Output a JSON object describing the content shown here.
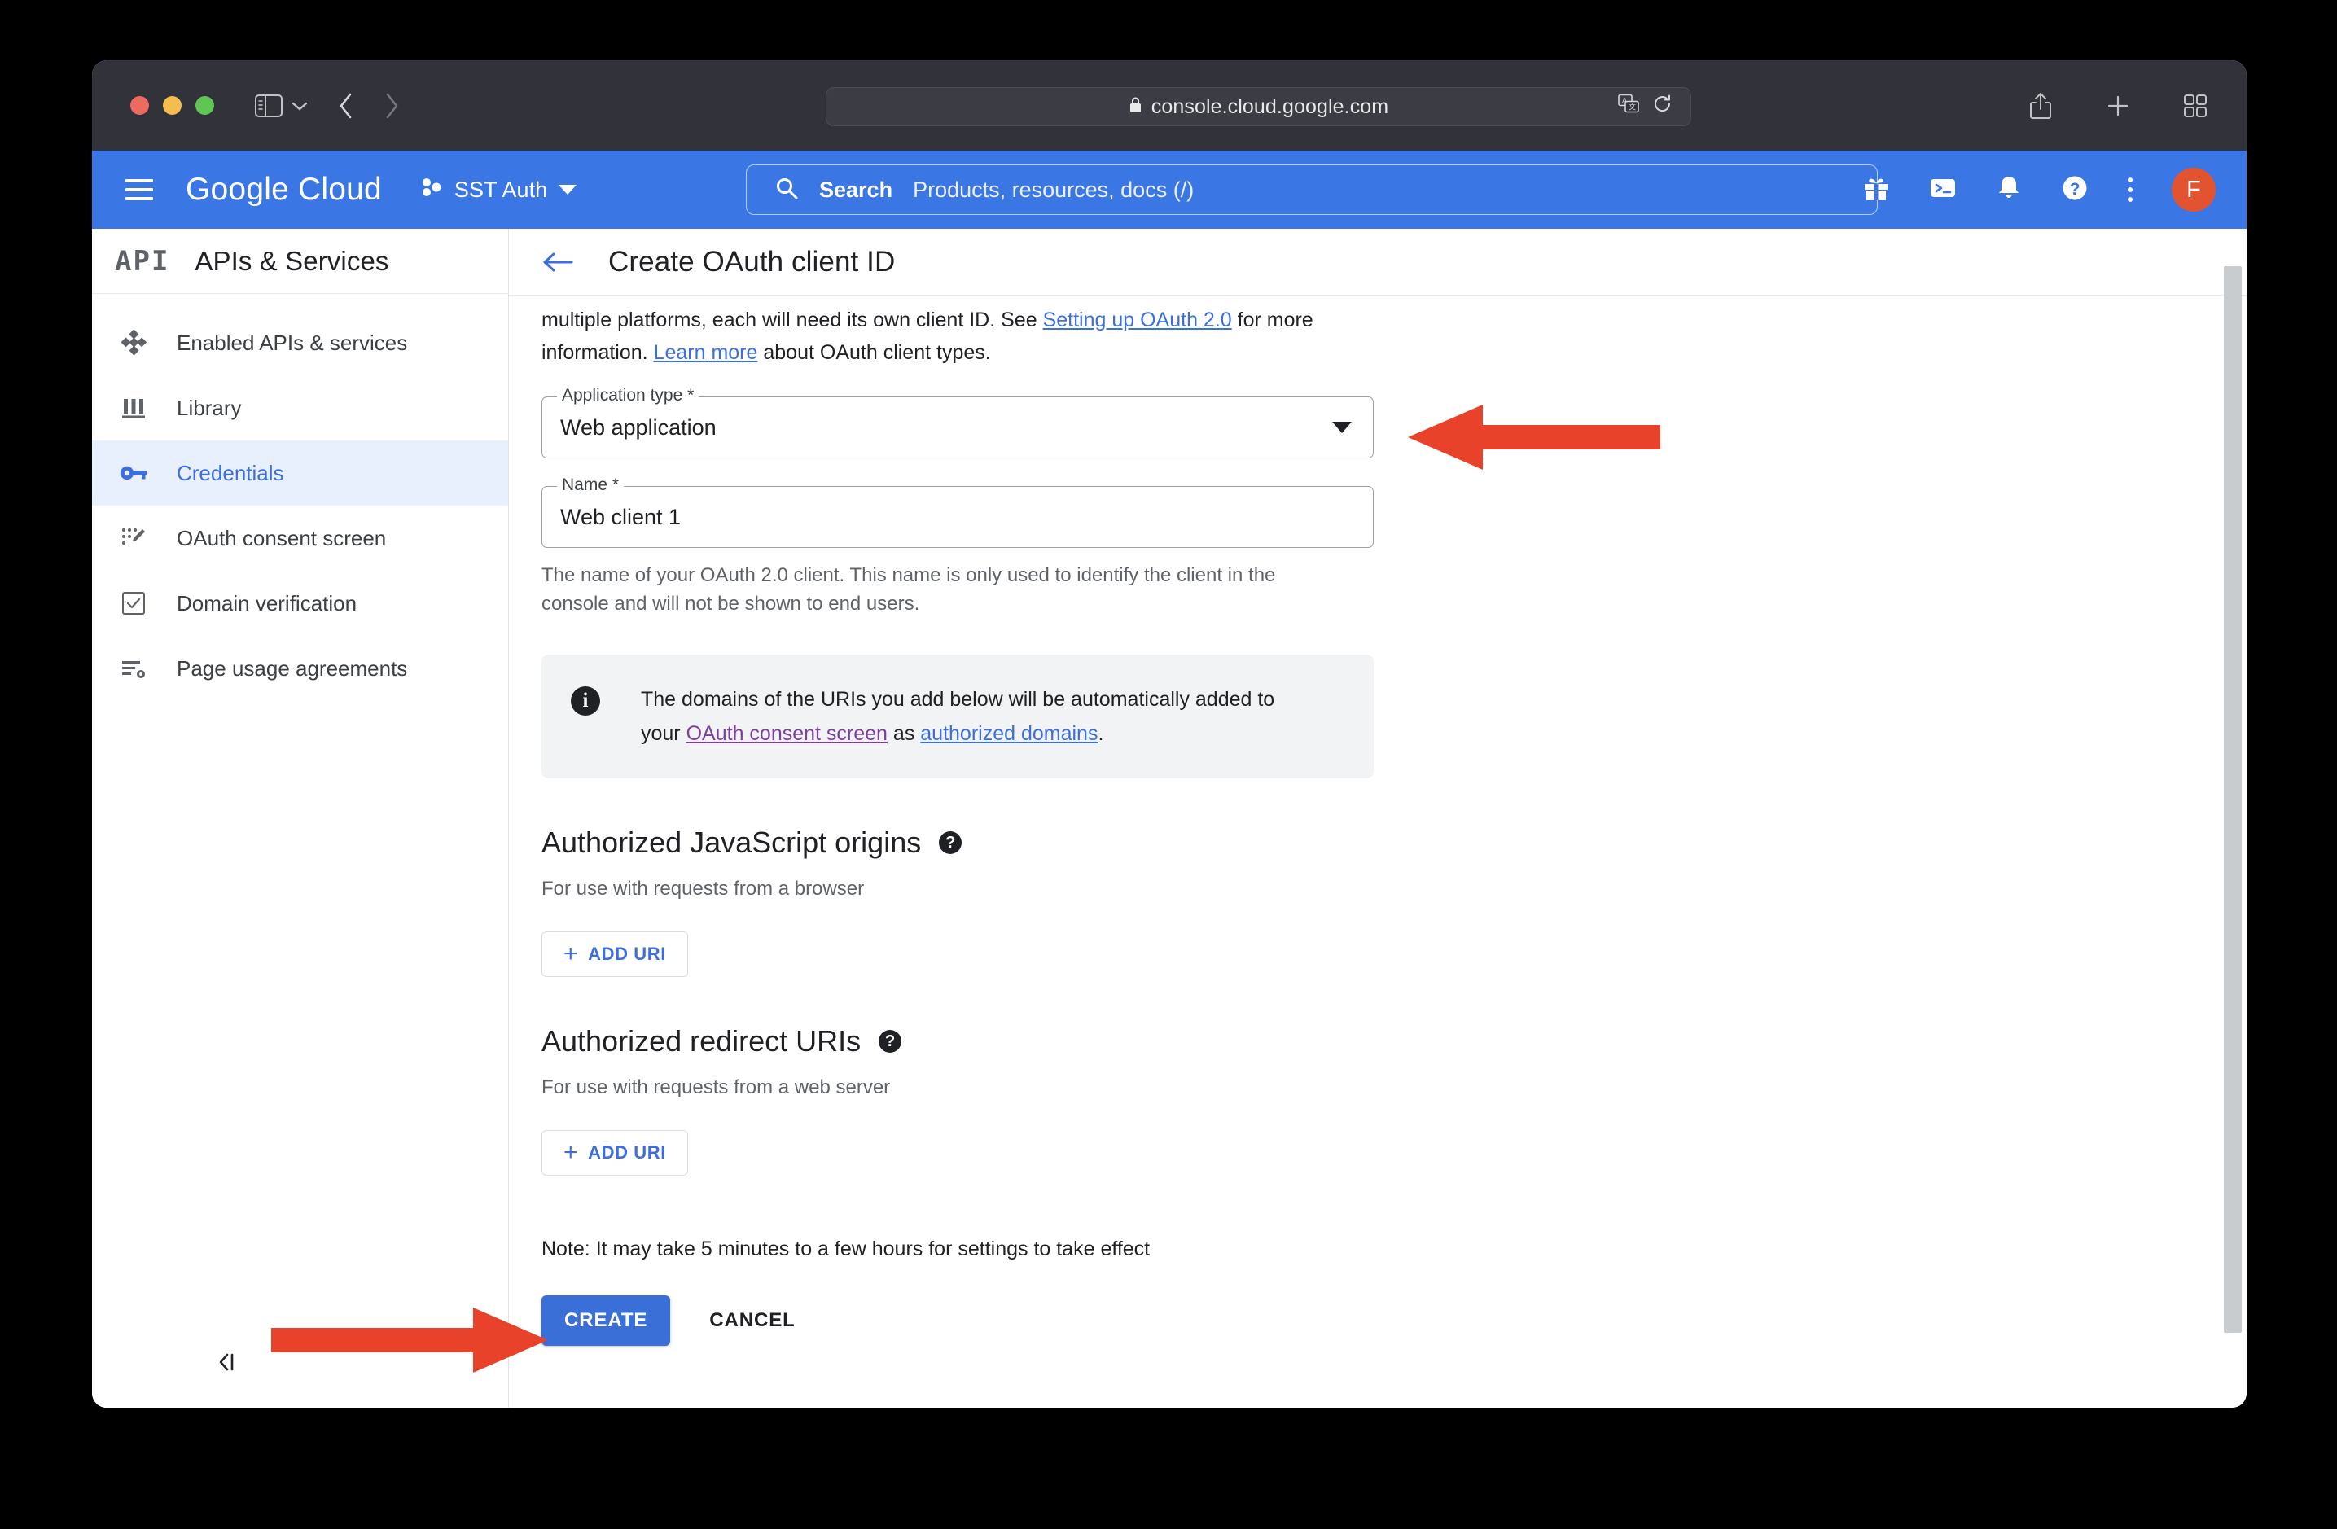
{
  "browser": {
    "url": "console.cloud.google.com",
    "lock_icon": "lock-icon",
    "translate_icon": "translate-icon",
    "reload_icon": "reload-icon",
    "sidebar_toggle_icon": "sidebar-toggle-icon",
    "back_icon": "back-arrow-icon",
    "forward_icon": "forward-arrow-icon",
    "share_icon": "share-icon",
    "new_tab_icon": "plus-icon",
    "tab_overview_icon": "tab-overview-icon"
  },
  "gc_header": {
    "logo": "Google Cloud",
    "project": "SST Auth",
    "menu_icon": "hamburger-icon",
    "project_icon": "project-icon",
    "search": {
      "label": "Search",
      "placeholder": "Products, resources, docs (/)",
      "icon": "search-icon"
    },
    "icons": [
      {
        "name": "gift-icon"
      },
      {
        "name": "cloud-shell-icon"
      },
      {
        "name": "notifications-bell-icon"
      },
      {
        "name": "help-icon"
      },
      {
        "name": "more-options-icon"
      }
    ],
    "avatar_initial": "F",
    "avatar_color": "#e2532f"
  },
  "sidebar": {
    "logo_text": "API",
    "title": "APIs & Services",
    "collapse_label": "collapse-nav-icon",
    "items": [
      {
        "label": "Enabled APIs & services",
        "icon": "enabled-apis-icon",
        "active": false
      },
      {
        "label": "Library",
        "icon": "library-icon",
        "active": false
      },
      {
        "label": "Credentials",
        "icon": "key-icon",
        "active": true
      },
      {
        "label": "OAuth consent screen",
        "icon": "oauth-consent-icon",
        "active": false
      },
      {
        "label": "Domain verification",
        "icon": "domain-verification-icon",
        "active": false
      },
      {
        "label": "Page usage agreements",
        "icon": "page-usage-icon",
        "active": false
      }
    ],
    "active_bg": "#e9f0fd",
    "active_color": "#3d6fdc"
  },
  "page": {
    "title": "Create OAuth client ID",
    "back_icon": "back-arrow-icon",
    "intro": {
      "line1_a": "multiple platforms, each will need its own client ID. See ",
      "link1": "Setting up OAuth 2.0",
      "line1_b": " for more",
      "line2_a": "information. ",
      "link2": "Learn more",
      "line2_b": " about OAuth client types."
    },
    "application_type": {
      "label": "Application type *",
      "value": "Web application",
      "caret_icon": "chevron-down-icon"
    },
    "name_field": {
      "label": "Name *",
      "value": "Web client 1",
      "helper": "The name of your OAuth 2.0 client. This name is only used to identify the client in the console and will not be shown to end users."
    },
    "info_box": {
      "icon": "info-icon",
      "text_a": "The domains of the URIs you add below will be automatically added to your ",
      "link1": "OAuth consent screen",
      "text_b": " as ",
      "link2": "authorized domains",
      "text_c": "."
    },
    "sections": [
      {
        "title": "Authorized JavaScript origins",
        "help_icon": "help-icon",
        "subtitle": "For use with requests from a browser",
        "add_button": "ADD URI"
      },
      {
        "title": "Authorized redirect URIs",
        "help_icon": "help-icon",
        "subtitle": "For use with requests from a web server",
        "add_button": "ADD URI"
      }
    ],
    "note": "Note: It may take 5 minutes to a few hours for settings to take effect",
    "create_button": "CREATE",
    "cancel_button": "CANCEL",
    "create_button_color": "#3a6fd8"
  },
  "annotations": {
    "color": "#e8432a",
    "arrow_1": "arrow-pointing-to-application-type",
    "arrow_2": "arrow-pointing-to-create-button"
  }
}
